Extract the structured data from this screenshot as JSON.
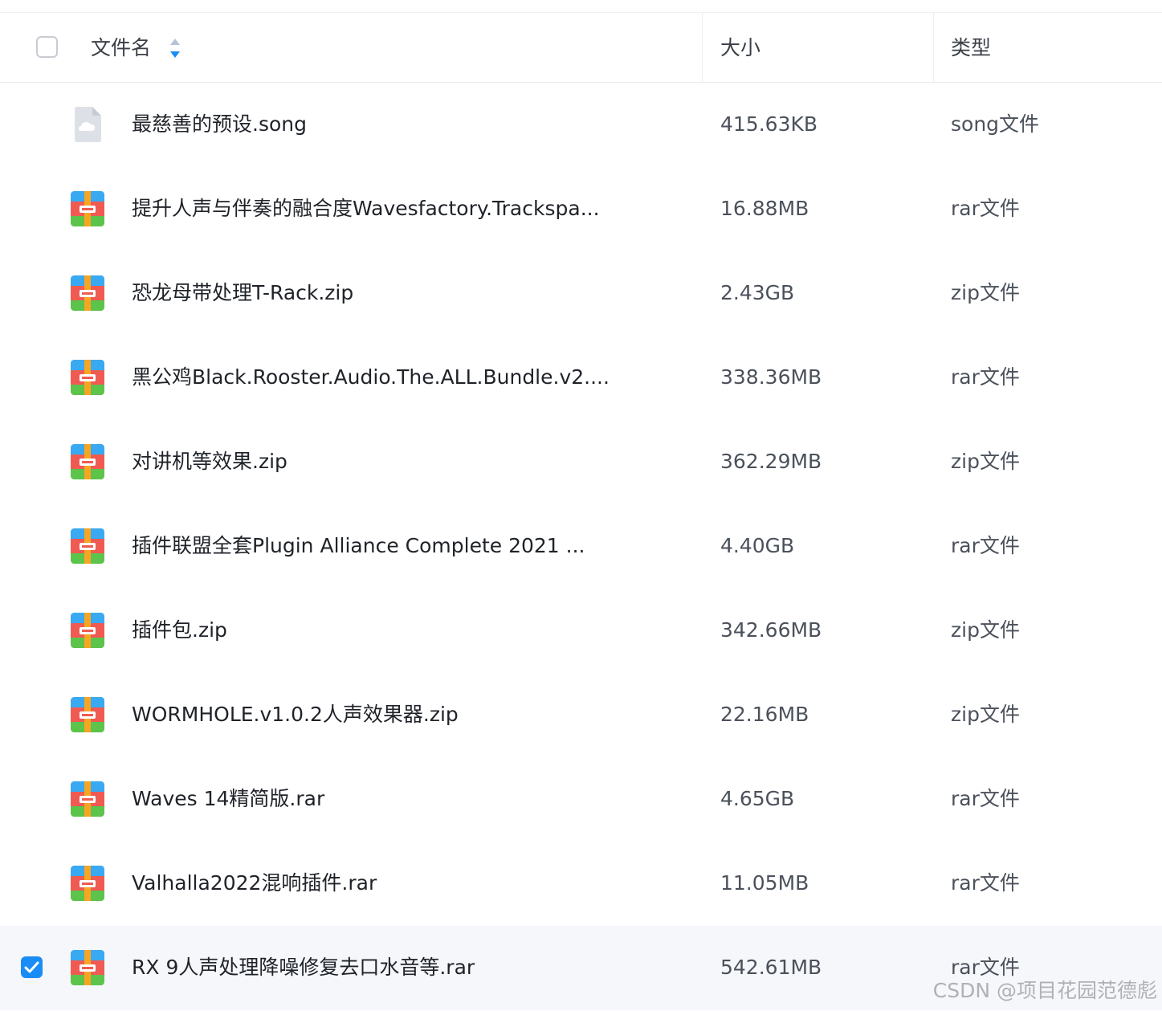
{
  "header": {
    "name_label": "文件名",
    "size_label": "大小",
    "type_label": "类型"
  },
  "files": [
    {
      "name": "最慈善的预设.song",
      "size": "415.63KB",
      "type": "song文件",
      "icon": "cloud-file-icon",
      "selected": false
    },
    {
      "name": "提升人声与伴奏的融合度Wavesfactory.Trackspa...",
      "size": "16.88MB",
      "type": "rar文件",
      "icon": "archive-icon",
      "selected": false
    },
    {
      "name": "恐龙母带处理T-Rack.zip",
      "size": "2.43GB",
      "type": "zip文件",
      "icon": "archive-icon",
      "selected": false
    },
    {
      "name": "黑公鸡Black.Rooster.Audio.The.ALL.Bundle.v2....",
      "size": "338.36MB",
      "type": "rar文件",
      "icon": "archive-icon",
      "selected": false
    },
    {
      "name": "对讲机等效果.zip",
      "size": "362.29MB",
      "type": "zip文件",
      "icon": "archive-icon",
      "selected": false
    },
    {
      "name": "插件联盟全套Plugin Alliance Complete 2021 ...",
      "size": "4.40GB",
      "type": "rar文件",
      "icon": "archive-icon",
      "selected": false
    },
    {
      "name": "插件包.zip",
      "size": "342.66MB",
      "type": "zip文件",
      "icon": "archive-icon",
      "selected": false
    },
    {
      "name": "WORMHOLE.v1.0.2人声效果器.zip",
      "size": "22.16MB",
      "type": "zip文件",
      "icon": "archive-icon",
      "selected": false
    },
    {
      "name": "Waves 14精简版.rar",
      "size": "4.65GB",
      "type": "rar文件",
      "icon": "archive-icon",
      "selected": false
    },
    {
      "name": "Valhalla2022混响插件.rar",
      "size": "11.05MB",
      "type": "rar文件",
      "icon": "archive-icon",
      "selected": false
    },
    {
      "name": "RX 9人声处理降噪修复去口水音等.rar",
      "size": "542.61MB",
      "type": "rar文件",
      "icon": "archive-icon",
      "selected": true
    }
  ],
  "watermark": "CSDN @项目花园范德彪",
  "colors": {
    "accent": "#1a8cf5",
    "selected_row_bg": "#f5f7fb"
  }
}
